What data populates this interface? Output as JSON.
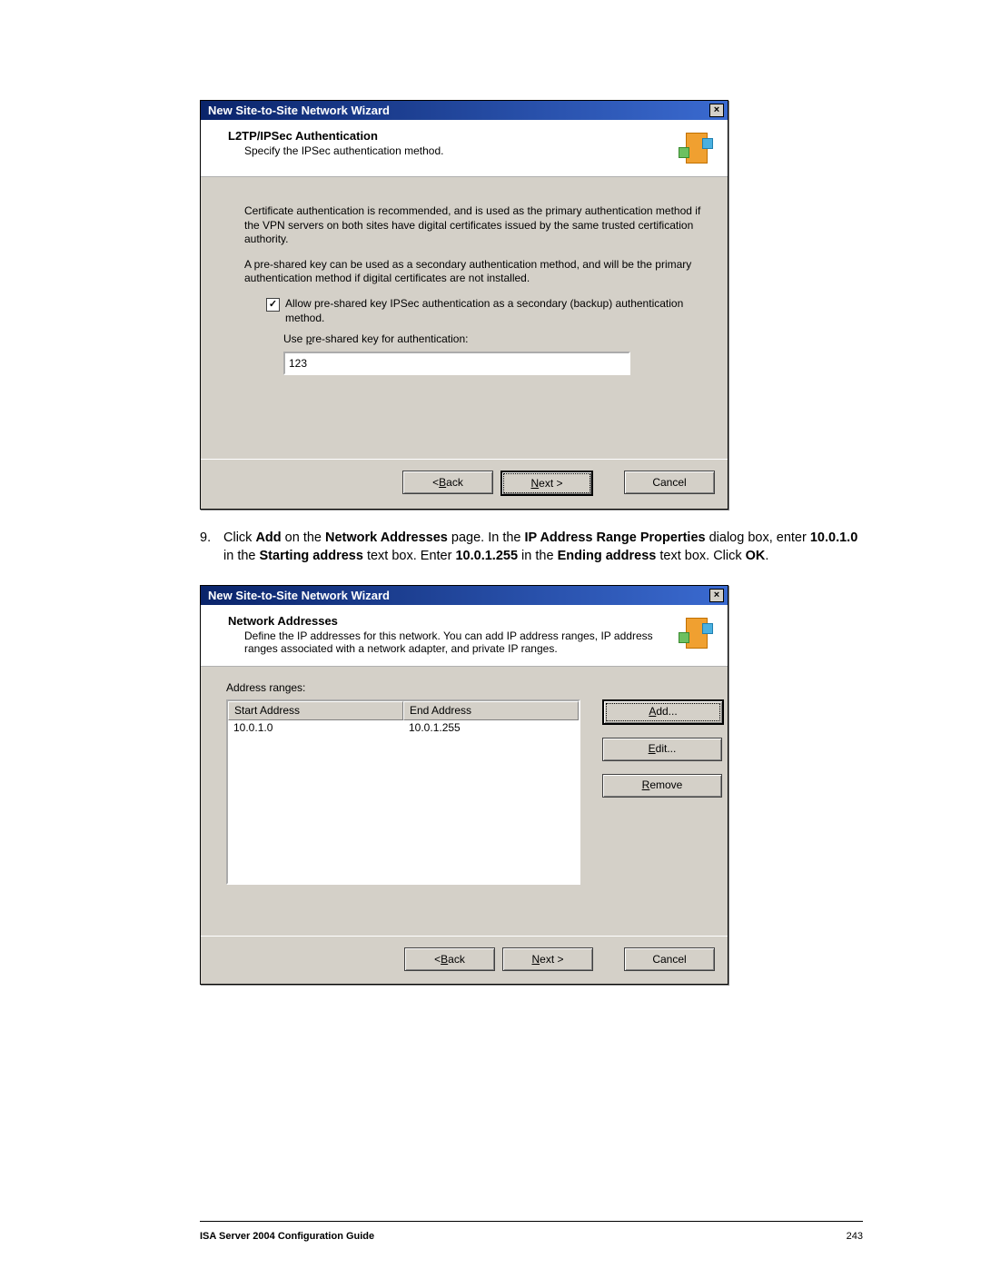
{
  "dialog1": {
    "title": "New Site-to-Site Network Wizard",
    "heading": "L2TP/IPSec Authentication",
    "subheading": "Specify the IPSec authentication method.",
    "para1": "Certificate authentication is recommended, and is used as the primary authentication method if the VPN servers on both sites have digital certificates issued by the same trusted certification authority.",
    "para2": "A pre-shared key can be used as a secondary authentication method, and will be the primary authentication method if digital certificates are not installed.",
    "checkbox_label": "Allow pre-shared key IPSec authentication as a secondary (backup) authentication method.",
    "key_label_pre": "Use ",
    "key_label_u": "p",
    "key_label_post": "re-shared key for authentication:",
    "key_value": "123",
    "back_pre": "< ",
    "back_u": "B",
    "back_post": "ack",
    "next_u": "N",
    "next_post": "ext >",
    "cancel": "Cancel"
  },
  "step": {
    "num": "9.",
    "t1": "Click ",
    "b1": "Add",
    "t2": " on the ",
    "b2": "Network Addresses",
    "t3": " page. In the ",
    "b3": "IP Address Range Properties",
    "t4": " dialog box, enter ",
    "b4": "10.0.1.0",
    "t5": " in the ",
    "b5": "Starting address",
    "t6": " text box. Enter ",
    "b6": "10.0.1.255",
    "t7": " in the ",
    "b7": "Ending address",
    "t8": " text box. Click ",
    "b8": "OK",
    "t9": "."
  },
  "dialog2": {
    "title": "New Site-to-Site Network Wizard",
    "heading": "Network Addresses",
    "subheading": "Define the IP addresses for this network. You can add IP address ranges, IP address ranges associated with a network adapter, and private IP ranges.",
    "ranges_label": "Address ranges:",
    "col1": "Start Address",
    "col2": "End Address",
    "row1c1": "10.0.1.0",
    "row1c2": "10.0.1.255",
    "add_u": "A",
    "add_post": "dd...",
    "edit_u": "E",
    "edit_post": "dit...",
    "remove_u": "R",
    "remove_post": "emove",
    "back_pre": "< ",
    "back_u": "B",
    "back_post": "ack",
    "next_u": "N",
    "next_post": "ext >",
    "cancel": "Cancel"
  },
  "footer": {
    "title": "ISA Server 2004 Configuration Guide",
    "page": "243"
  }
}
